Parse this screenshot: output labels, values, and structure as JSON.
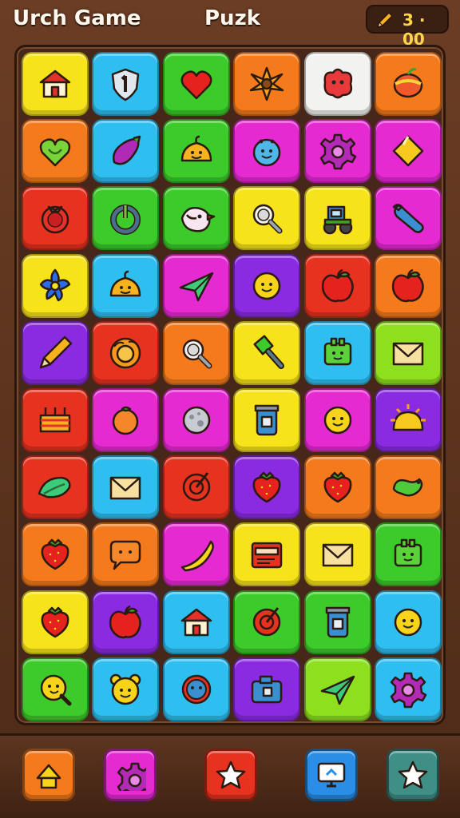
{
  "header": {
    "left_title": "Urch Game",
    "center_title": "Puzk",
    "timer": "3 · 00",
    "timer_icon": "pencil-icon"
  },
  "colors": {
    "yellow": "#f7e31a",
    "cyan": "#2fbef0",
    "green": "#3ccb2a",
    "orange": "#f57a1c",
    "white": "#f2f2f0",
    "red": "#e6321f",
    "magenta": "#e62ad2",
    "purple": "#8a2be2",
    "lime": "#8ee01e"
  },
  "grid": [
    [
      {
        "color": "yellow",
        "icon": "house"
      },
      {
        "color": "cyan",
        "icon": "shield"
      },
      {
        "color": "green",
        "icon": "heart"
      },
      {
        "color": "orange",
        "icon": "sunflower"
      },
      {
        "color": "white",
        "icon": "blob"
      },
      {
        "color": "orange",
        "icon": "fruit"
      }
    ],
    [
      {
        "color": "orange",
        "icon": "leaf-heart"
      },
      {
        "color": "cyan",
        "icon": "eggplant"
      },
      {
        "color": "green",
        "icon": "slime"
      },
      {
        "color": "magenta",
        "icon": "bug"
      },
      {
        "color": "magenta",
        "icon": "gear"
      },
      {
        "color": "magenta",
        "icon": "diamond"
      }
    ],
    [
      {
        "color": "red",
        "icon": "tomato"
      },
      {
        "color": "green",
        "icon": "power"
      },
      {
        "color": "green",
        "icon": "bird"
      },
      {
        "color": "yellow",
        "icon": "magnifier"
      },
      {
        "color": "yellow",
        "icon": "tractor"
      },
      {
        "color": "magenta",
        "icon": "wrench"
      }
    ],
    [
      {
        "color": "yellow",
        "icon": "flower"
      },
      {
        "color": "cyan",
        "icon": "slime"
      },
      {
        "color": "magenta",
        "icon": "plane"
      },
      {
        "color": "purple",
        "icon": "smiley"
      },
      {
        "color": "red",
        "icon": "apple"
      },
      {
        "color": "orange",
        "icon": "apple"
      }
    ],
    [
      {
        "color": "purple",
        "icon": "pencil"
      },
      {
        "color": "red",
        "icon": "lion"
      },
      {
        "color": "orange",
        "icon": "magnifier"
      },
      {
        "color": "yellow",
        "icon": "brush"
      },
      {
        "color": "cyan",
        "icon": "box"
      },
      {
        "color": "lime",
        "icon": "envelope"
      }
    ],
    [
      {
        "color": "red",
        "icon": "basket"
      },
      {
        "color": "magenta",
        "icon": "orange-fruit"
      },
      {
        "color": "magenta",
        "icon": "moon"
      },
      {
        "color": "yellow",
        "icon": "jar"
      },
      {
        "color": "magenta",
        "icon": "smiley"
      },
      {
        "color": "purple",
        "icon": "sun"
      }
    ],
    [
      {
        "color": "red",
        "icon": "leaf"
      },
      {
        "color": "cyan",
        "icon": "envelope"
      },
      {
        "color": "red",
        "icon": "target"
      },
      {
        "color": "purple",
        "icon": "strawberry"
      },
      {
        "color": "orange",
        "icon": "strawberry"
      },
      {
        "color": "orange",
        "icon": "snake"
      }
    ],
    [
      {
        "color": "orange",
        "icon": "strawberry"
      },
      {
        "color": "orange",
        "icon": "chat"
      },
      {
        "color": "magenta",
        "icon": "banana"
      },
      {
        "color": "yellow",
        "icon": "radio"
      },
      {
        "color": "yellow",
        "icon": "envelope"
      },
      {
        "color": "green",
        "icon": "box"
      }
    ],
    [
      {
        "color": "yellow",
        "icon": "strawberry"
      },
      {
        "color": "purple",
        "icon": "apple"
      },
      {
        "color": "cyan",
        "icon": "house"
      },
      {
        "color": "green",
        "icon": "target"
      },
      {
        "color": "green",
        "icon": "jar"
      },
      {
        "color": "cyan",
        "icon": "smiley"
      }
    ],
    [
      {
        "color": "green",
        "icon": "magnifier-smile"
      },
      {
        "color": "cyan",
        "icon": "bear"
      },
      {
        "color": "cyan",
        "icon": "globe"
      },
      {
        "color": "purple",
        "icon": "camera"
      },
      {
        "color": "lime",
        "icon": "plane"
      },
      {
        "color": "cyan",
        "icon": "gear"
      }
    ]
  ],
  "footer": [
    {
      "name": "home-button",
      "color": "#f57a1c",
      "icon": "home"
    },
    {
      "name": "settings-button",
      "color": "#e62ad2",
      "icon": "gear"
    },
    {
      "name": "star-button",
      "color": "#e6321f",
      "icon": "star"
    },
    {
      "name": "display-button",
      "color": "#2a8ee6",
      "icon": "display"
    },
    {
      "name": "favorite-button",
      "color": "#3f8f86",
      "icon": "star"
    }
  ]
}
